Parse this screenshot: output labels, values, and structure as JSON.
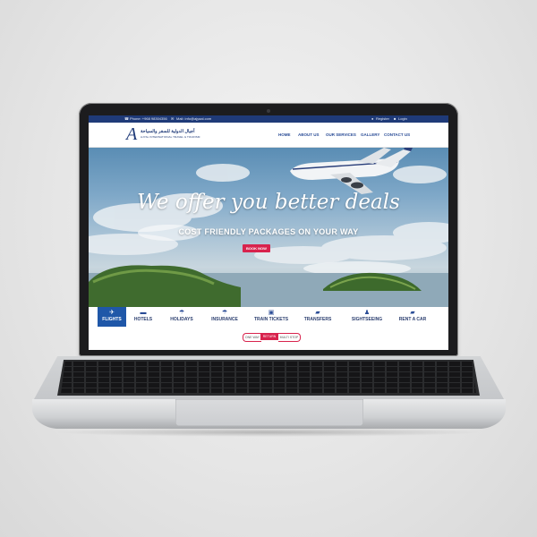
{
  "topbar": {
    "phone": "Phone: +968 98304356",
    "email": "Mail: info@ajyaal.com",
    "register": "Register",
    "login": "Login"
  },
  "brand": {
    "mark": "A",
    "name_ar": "أجيال الدولية للسفر والسياحة",
    "name_en": "AJYAL INTERNATIONAL TRAVEL & TOURISM"
  },
  "nav": {
    "items": [
      "HOME",
      "ABOUT US",
      "OUR SERVICES",
      "GALLERY",
      "CONTACT US"
    ]
  },
  "hero": {
    "title": "We offer you better deals",
    "subtitle": "COST FRIENDLY PACKAGES ON YOUR WAY",
    "cta": "BOOK NOW"
  },
  "services": {
    "tabs": [
      {
        "label": "FLIGHTS",
        "icon": "airplane-icon",
        "active": true
      },
      {
        "label": "HOTELS",
        "icon": "bed-icon",
        "active": false
      },
      {
        "label": "HOLIDAYS",
        "icon": "umbrella-icon",
        "active": false
      },
      {
        "label": "INSURANCE",
        "icon": "umbrella-shield-icon",
        "active": false
      },
      {
        "label": "TRAIN TICKETS",
        "icon": "train-icon",
        "active": false
      },
      {
        "label": "TRANSFERS",
        "icon": "car-icon",
        "active": false
      },
      {
        "label": "SIGHTSEEING",
        "icon": "person-icon",
        "active": false
      },
      {
        "label": "RENT A CAR",
        "icon": "car-icon",
        "active": false
      }
    ]
  },
  "trip_type": {
    "options": [
      "ONE WAY",
      "RETURN",
      "MULTI STOP"
    ],
    "selected": "RETURN"
  },
  "colors": {
    "brand_blue": "#1f3a78",
    "active_tab": "#1f57a8",
    "cta_red": "#d8234d"
  }
}
